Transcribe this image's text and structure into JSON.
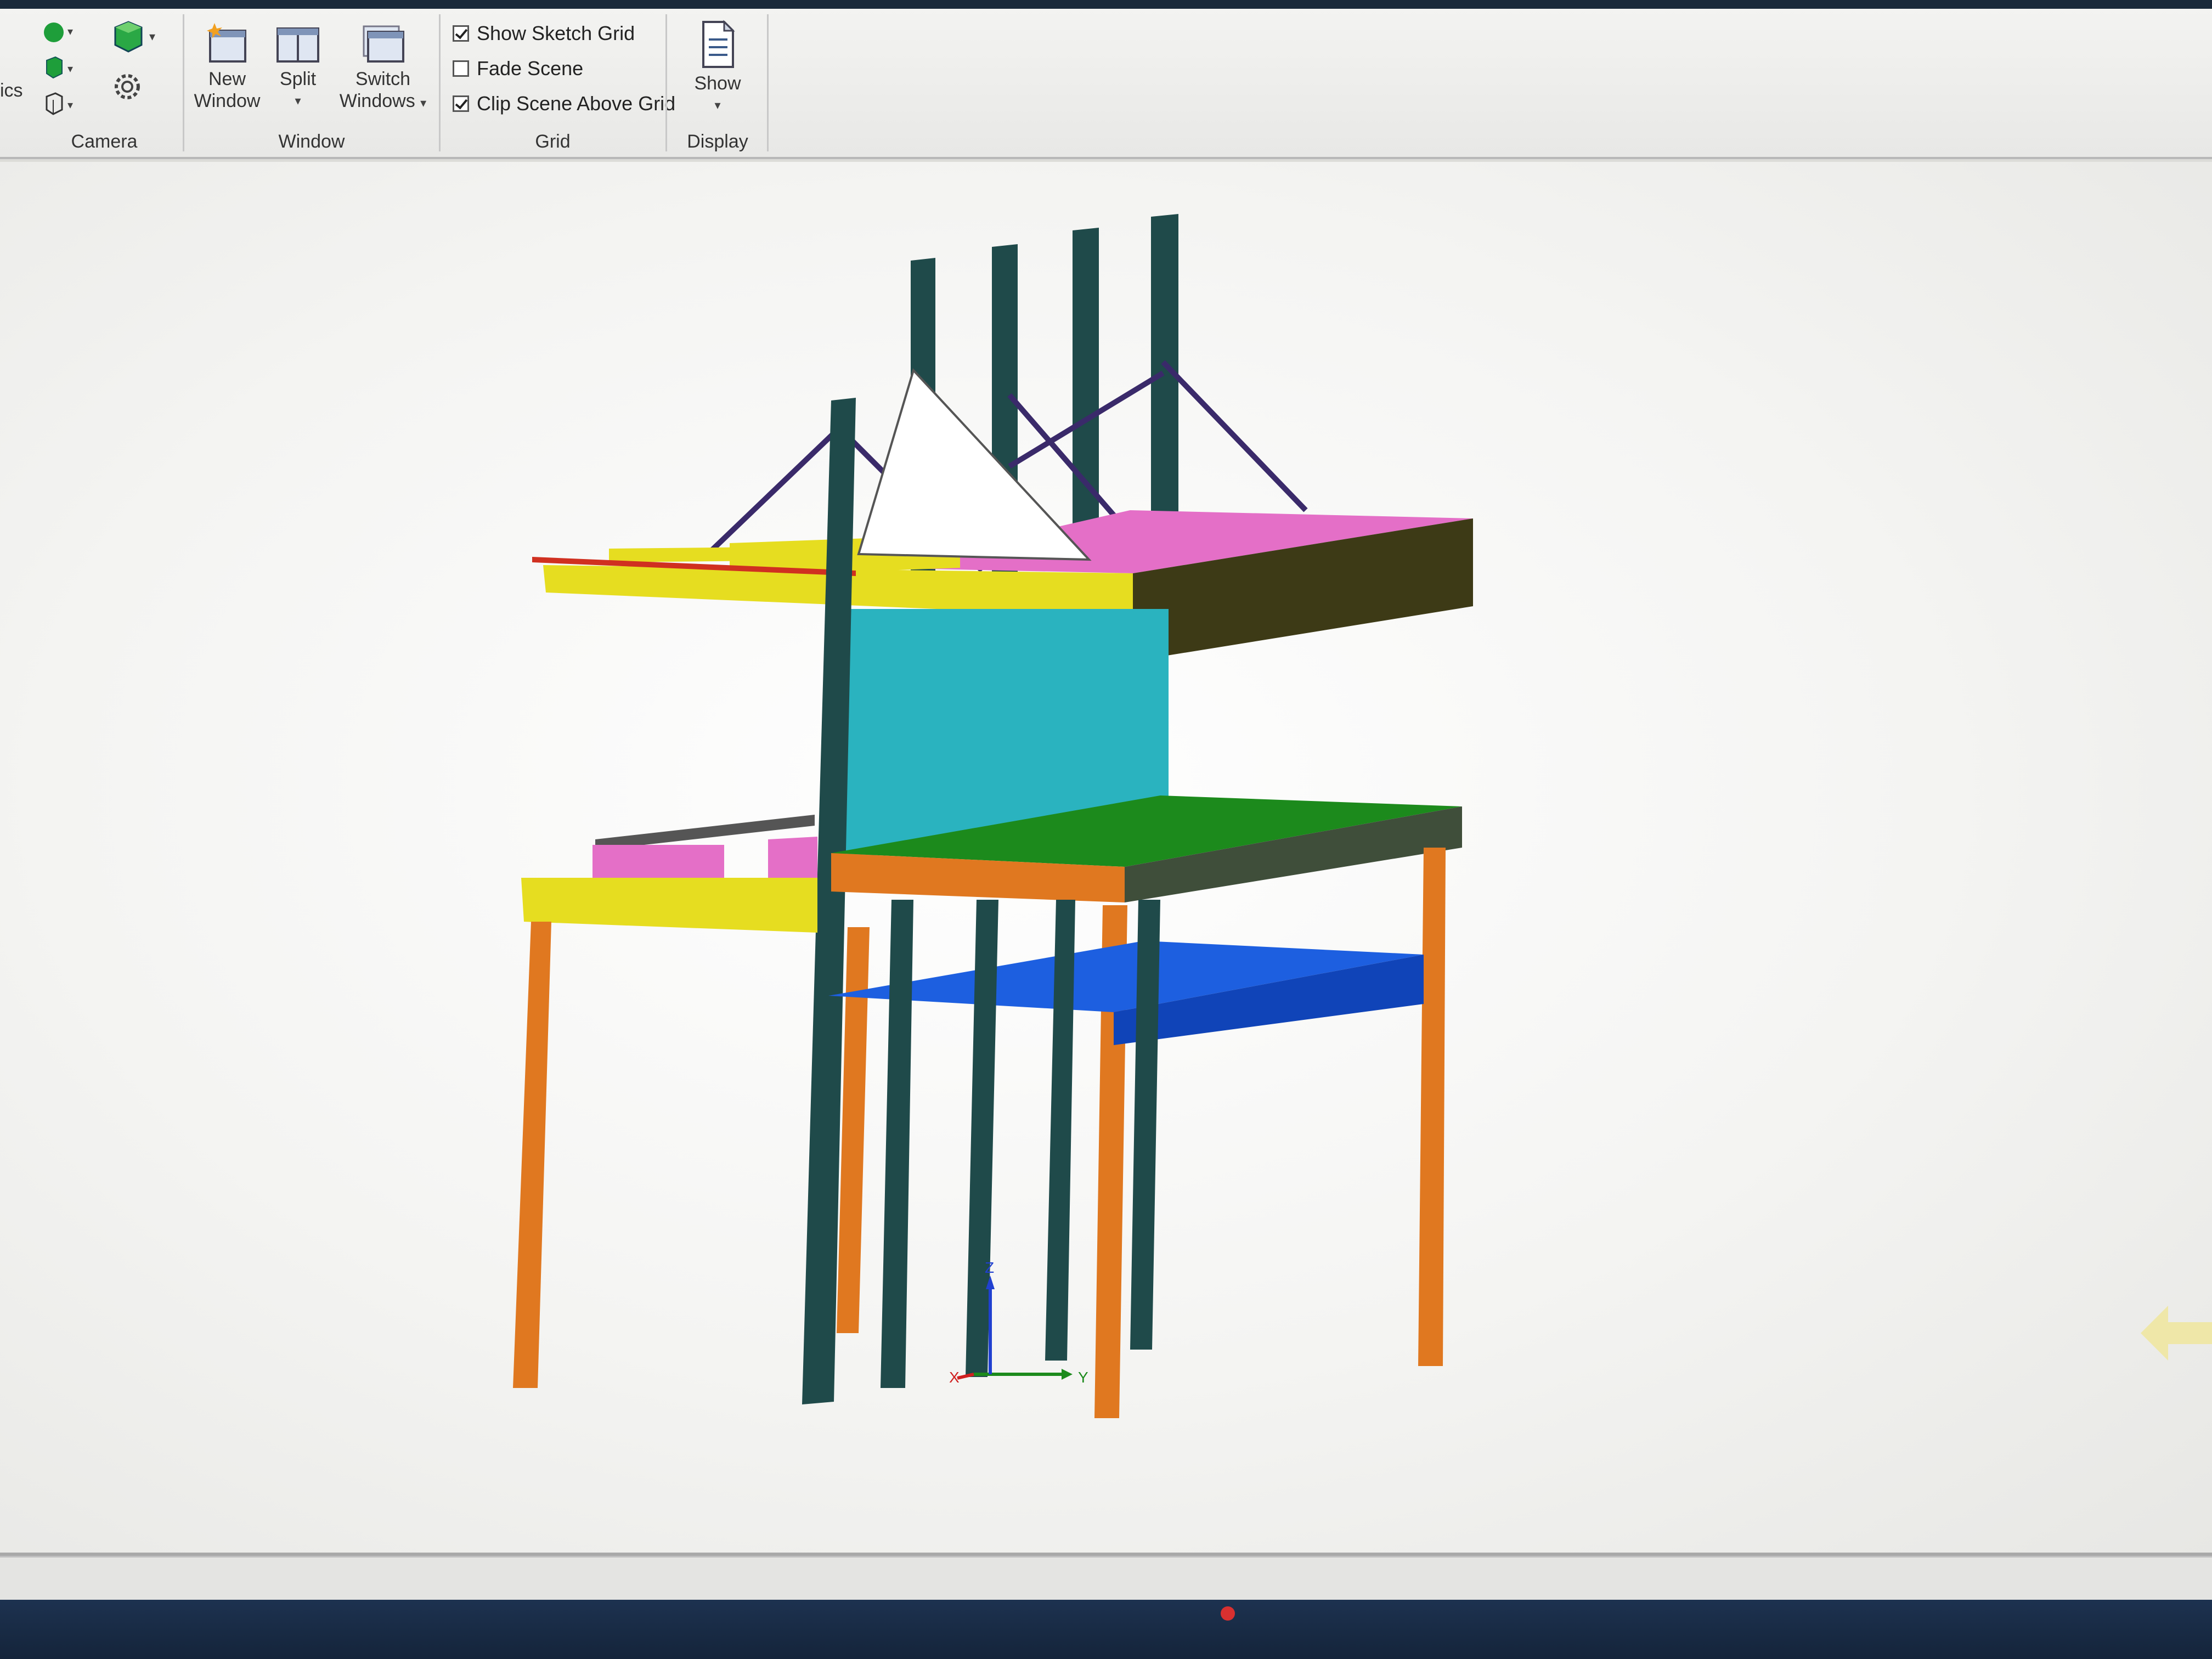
{
  "ribbon": {
    "partial_left_label": "ics",
    "camera": {
      "group_label": "Camera"
    },
    "window": {
      "group_label": "Window",
      "new_window_label_line1": "New",
      "new_window_label_line2": "Window",
      "split_label": "Split",
      "switch_windows_label_line1": "Switch",
      "switch_windows_label_line2": "Windows"
    },
    "grid": {
      "group_label": "Grid",
      "show_sketch_grid_label": "Show Sketch Grid",
      "show_sketch_grid_checked": true,
      "fade_scene_label": "Fade Scene",
      "fade_scene_checked": false,
      "clip_scene_label": "Clip Scene Above Grid",
      "clip_scene_checked": true
    },
    "display": {
      "group_label": "Display",
      "show_label": "Show"
    }
  },
  "viewport": {
    "axis_x_label": "X",
    "axis_y_label": "Y",
    "axis_z_label": "Z"
  },
  "colors": {
    "post_teal": "#1f4a4a",
    "panel_cyan": "#2ab3bf",
    "shelf_pink": "#e46fc7",
    "shelf_yellow": "#e6dd20",
    "shelf_green": "#1c8a1c",
    "tray_blue": "#1d5fe0",
    "leg_orange": "#e07820",
    "dark_olive": "#3d3a16"
  }
}
